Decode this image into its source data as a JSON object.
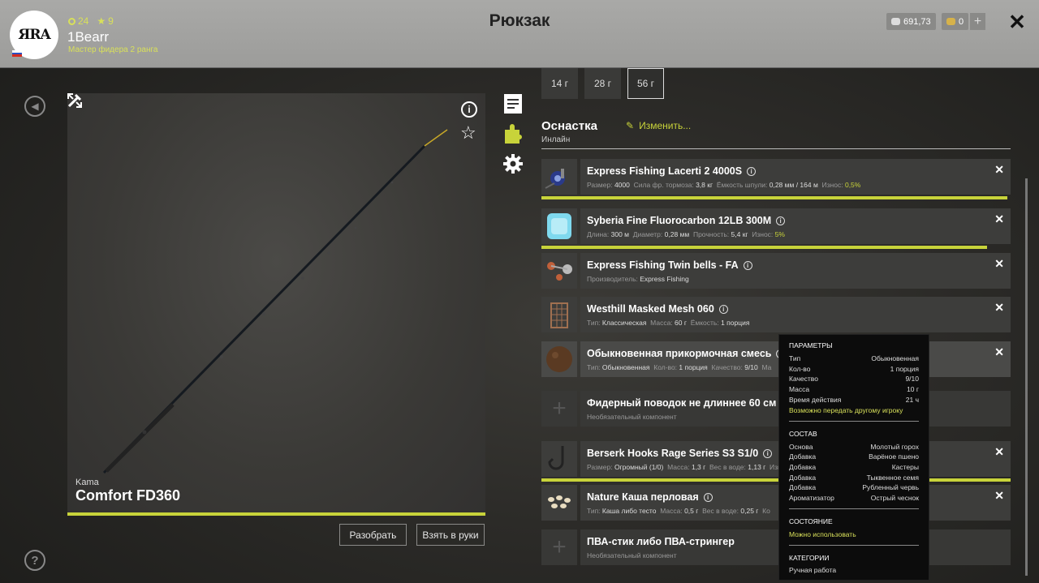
{
  "header": {
    "title": "Рюкзак",
    "username": "1Bearr",
    "rank": "Мастер фидера 2 ранга",
    "avatar_text": "ЯRA",
    "stat_coins": "24",
    "stat_stars": "9",
    "silver": "691,73",
    "gold": "0",
    "plus_label": "+",
    "close_label": "✕"
  },
  "rod": {
    "brand": "Kama",
    "name": "Comfort FD360",
    "disassemble_label": "Разобрать",
    "take_label": "Взять в руки"
  },
  "weight_tabs": [
    "14 г",
    "28 г",
    "56 г"
  ],
  "rig": {
    "title": "Оснастка",
    "subtitle": "Инлайн",
    "edit_label": "Изменить..."
  },
  "items": [
    {
      "name": "Express Fishing Lacerti 2 4000S",
      "props": [
        [
          "Размер:",
          "4000"
        ],
        [
          "Сила фр. тормоза:",
          "3,8 кг"
        ],
        [
          "Ёмкость шпули:",
          "0,28 мм / 164 м"
        ],
        [
          "Износ:",
          "0,5%"
        ]
      ],
      "wear_progress": 0.995
    },
    {
      "name": "Syberia Fine Fluorocarbon 12LB 300M",
      "props": [
        [
          "Длина:",
          "300 м"
        ],
        [
          "Диаметр:",
          "0,28 мм"
        ],
        [
          "Прочность:",
          "5,4 кг"
        ],
        [
          "Износ:",
          "5%"
        ]
      ],
      "wear_progress": 0.95
    },
    {
      "name": "Express Fishing Twin bells - FA",
      "props": [
        [
          "Производитель:",
          "Express Fishing"
        ]
      ]
    },
    {
      "name": "Westhill Masked Mesh 060",
      "props": [
        [
          "Тип:",
          "Классическая"
        ],
        [
          "Масса:",
          "60 г"
        ],
        [
          "Ёмкость:",
          "1 порция"
        ]
      ]
    },
    {
      "name": "Обыкновенная прикормочная смесь",
      "props": [
        [
          "Тип:",
          "Обыкновенная"
        ],
        [
          "Кол-во:",
          "1 порция"
        ],
        [
          "Качество:",
          "9/10"
        ],
        [
          "Ма",
          ""
        ]
      ]
    },
    {
      "name": "Фидерный поводок не длиннее 60 см",
      "props": [
        [
          "Необязательный компонент",
          ""
        ]
      ]
    },
    {
      "name": "Berserk Hooks Rage Series S3 S1/0",
      "props": [
        [
          "Размер:",
          "Огромный (1/0)"
        ],
        [
          "Масса:",
          "1,3 г"
        ],
        [
          "Вес в воде:",
          "1,13 г"
        ],
        [
          "Изн",
          ""
        ]
      ],
      "wear_progress": 1.0
    },
    {
      "name": "Nature Каша перловая",
      "props": [
        [
          "Тип:",
          "Каша либо тесто"
        ],
        [
          "Масса:",
          "0,5 г"
        ],
        [
          "Вес в воде:",
          "0,25 г"
        ],
        [
          "Ко",
          ""
        ]
      ]
    },
    {
      "name": "ПВА-стик либо ПВА-стрингер",
      "props": [
        [
          "Необязательный компонент",
          ""
        ]
      ]
    }
  ],
  "tooltip": {
    "params_title": "ПАРАМЕТРЫ",
    "params": [
      [
        "Тип",
        "Обыкновенная"
      ],
      [
        "Кол-во",
        "1 порция"
      ],
      [
        "Качество",
        "9/10"
      ],
      [
        "Масса",
        "10 г"
      ],
      [
        "Время действия",
        "21 ч"
      ]
    ],
    "transfer": "Возможно передать другому игроку",
    "composition_title": "СОСТАВ",
    "composition": [
      [
        "Основа",
        "Молотый горох"
      ],
      [
        "Добавка",
        "Варёное пшено"
      ],
      [
        "Добавка",
        "Кастеры"
      ],
      [
        "Добавка",
        "Тыквенное семя"
      ],
      [
        "Добавка",
        "Рубленный червь"
      ],
      [
        "Ароматизатор",
        "Острый чеснок"
      ]
    ],
    "state_title": "СОСТОЯНИЕ",
    "state": "Можно использовать",
    "categories_title": "КАТЕГОРИИ",
    "category": "Ручная работа"
  },
  "colors": {
    "accent": "#c8d33a",
    "header_bg": "#a9a9a7"
  }
}
